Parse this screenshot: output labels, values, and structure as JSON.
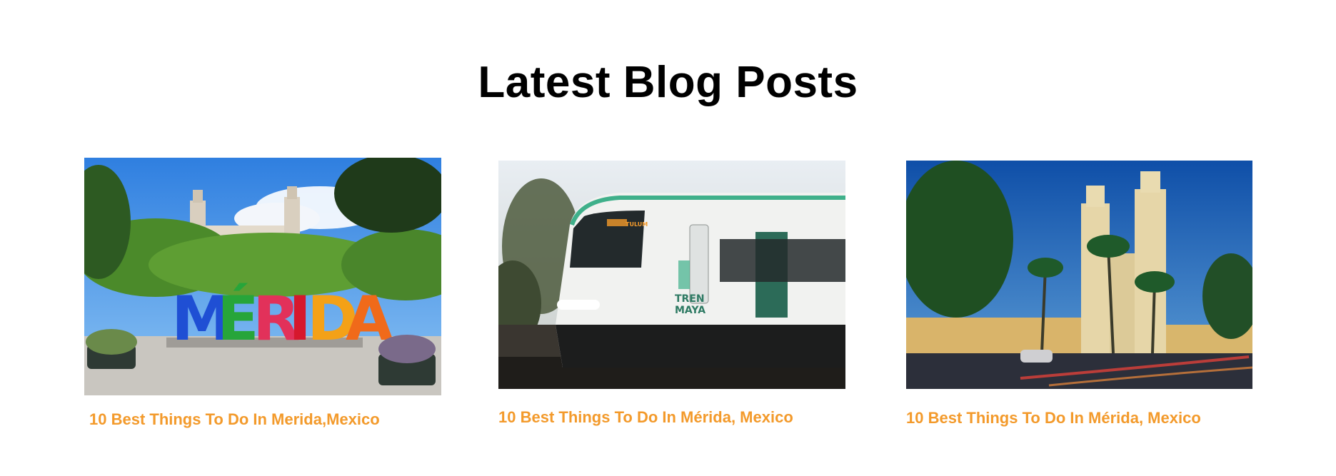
{
  "section": {
    "title": "Latest Blog Posts"
  },
  "posts": [
    {
      "title": "10 Best Things To Do In Merida,Mexico",
      "image": "merida-letters-sign-image",
      "sign_text": "MÉRIDA"
    },
    {
      "title": "10 Best Things To Do In Mérida, Mexico",
      "image": "tren-maya-train-image",
      "train_logo_line1": "TREN",
      "train_logo_line2": "MAYA",
      "train_destination": "TULUM"
    },
    {
      "title": "10 Best Things To Do In Mérida, Mexico",
      "image": "cathedral-night-image"
    }
  ],
  "colors": {
    "post_title": "#f39a2b",
    "heading": "#000000",
    "background": "#ffffff"
  }
}
